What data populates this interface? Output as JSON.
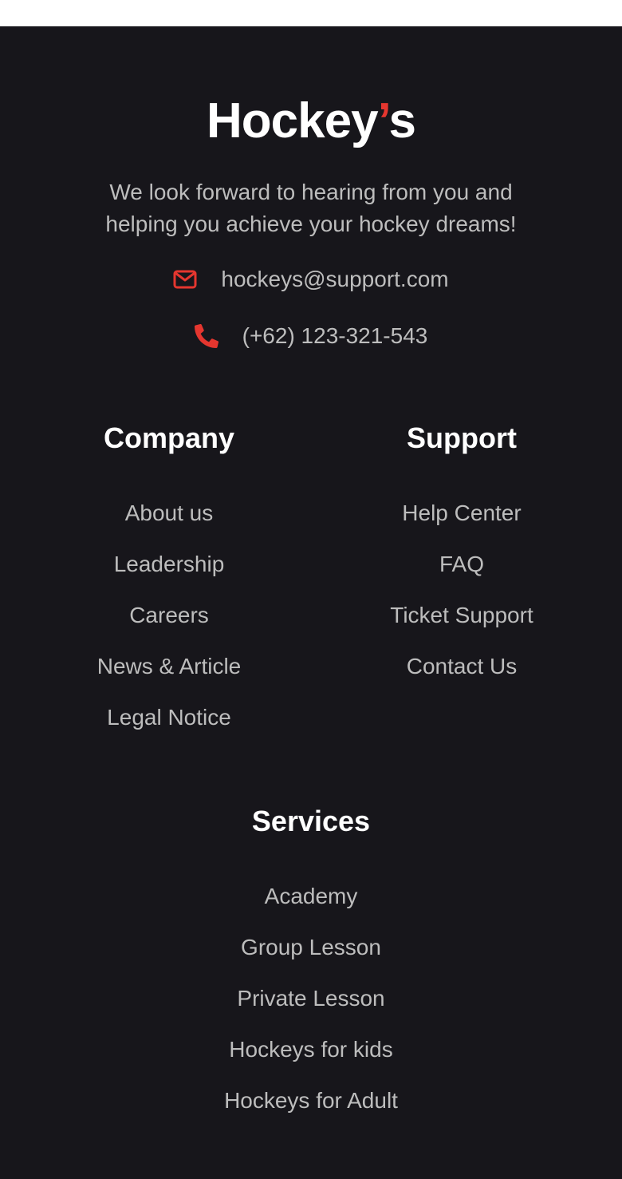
{
  "brand": {
    "name_main": "Hockey",
    "name_apostrophe": "’",
    "name_suffix": "s",
    "accent_color": "#e5362f"
  },
  "tagline": "We look forward to hearing from you and helping you achieve your hockey dreams!",
  "contact": {
    "email": {
      "icon": "envelope-icon",
      "value": "hockeys@support.com"
    },
    "phone": {
      "icon": "phone-icon",
      "value": "(+62) 123-321-543"
    }
  },
  "company": {
    "title": "Company",
    "links": [
      "About us",
      "Leadership",
      "Careers",
      "News & Article",
      "Legal Notice"
    ]
  },
  "support": {
    "title": "Support",
    "links": [
      "Help Center",
      "FAQ",
      "Ticket Support",
      "Contact Us"
    ]
  },
  "services": {
    "title": "Services",
    "links": [
      "Academy",
      "Group Lesson",
      "Private Lesson",
      "Hockeys for kids",
      "Hockeys for Adult"
    ]
  }
}
